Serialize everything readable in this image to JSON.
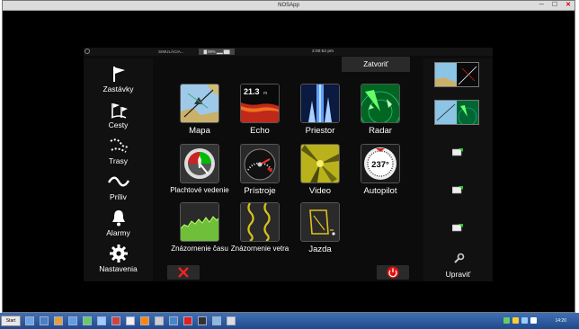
{
  "window": {
    "title": "NOSApp"
  },
  "statusbar": {
    "sim": "SIMULÁCIA...",
    "badge": "▇ 99% ▂▂ ▇▇",
    "time": "2:00:52 pm"
  },
  "nav": [
    {
      "label": "Zastávky",
      "icon": "flag-icon"
    },
    {
      "label": "Cesty",
      "icon": "route-flags-icon"
    },
    {
      "label": "Trasy",
      "icon": "trail-icon"
    },
    {
      "label": "Príliv",
      "icon": "tide-icon"
    },
    {
      "label": "Alarmy",
      "icon": "bell-icon"
    },
    {
      "label": "Nastavenia",
      "icon": "gear-icon"
    }
  ],
  "close_label": "Zatvoriť",
  "apps": [
    {
      "label": "Mapa",
      "icon": "chart-map-icon"
    },
    {
      "label": "Echo",
      "icon": "echo-sonar-icon",
      "value": "21.3",
      "unit": "m"
    },
    {
      "label": "Priestor",
      "icon": "structure-scan-icon"
    },
    {
      "label": "Radar",
      "icon": "radar-icon"
    },
    {
      "label": "Plachtové vedenie",
      "icon": "sailing-icon"
    },
    {
      "label": "Prístroje",
      "icon": "gauge-icon"
    },
    {
      "label": "Video",
      "icon": "video-icon"
    },
    {
      "label": "Autopilot",
      "icon": "autopilot-icon",
      "value": "237°"
    },
    {
      "label": "Znázornenie času",
      "icon": "time-plot-icon"
    },
    {
      "label": "Znázornenie vetra",
      "icon": "wind-plot-icon"
    },
    {
      "label": "Jazda",
      "icon": "trolling-icon"
    }
  ],
  "right": {
    "edit_label": "Upraviť"
  },
  "bottom": {
    "left_icon": "close-x-icon",
    "right_icon": "power-icon"
  },
  "taskbar": {
    "start": "Start",
    "time": "14:20"
  },
  "colors": {
    "accent": "#e8e8e8",
    "power": "#d11",
    "x": "#e22",
    "tile_bg": "#222"
  }
}
